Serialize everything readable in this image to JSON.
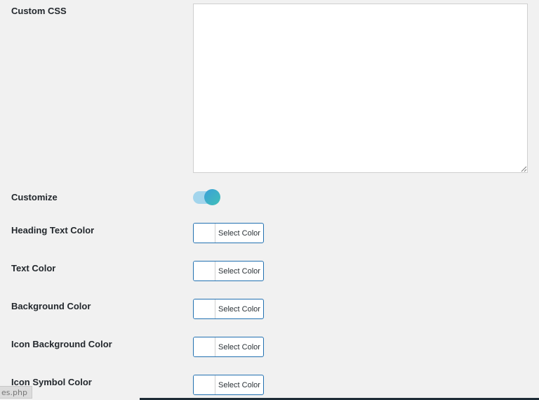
{
  "settings": {
    "custom_css": {
      "label": "Custom CSS",
      "value": ""
    },
    "customize": {
      "label": "Customize",
      "enabled": true
    },
    "colors": [
      {
        "label": "Heading Text Color",
        "button": "Select Color"
      },
      {
        "label": "Text Color",
        "button": "Select Color"
      },
      {
        "label": "Background Color",
        "button": "Select Color"
      },
      {
        "label": "Icon Background Color",
        "button": "Select Color"
      },
      {
        "label": "Icon Symbol Color",
        "button": "Select Color"
      }
    ]
  },
  "status_bar": {
    "url": "es.php"
  },
  "theme": {
    "accent": "#2271b1",
    "toggle_track": "#a3d5ec",
    "toggle_knob_start": "#3aa0d8",
    "toggle_knob_end": "#41bfb8",
    "background": "#f1f1f1"
  }
}
